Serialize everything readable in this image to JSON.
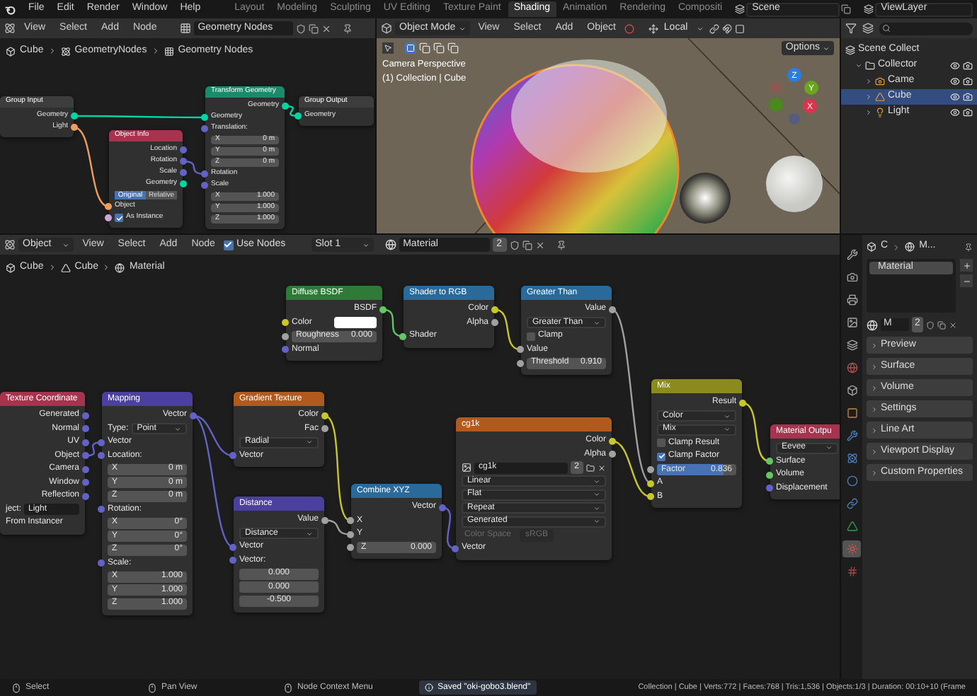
{
  "menu": [
    "File",
    "Edit",
    "Render",
    "Window",
    "Help"
  ],
  "workspaces": [
    {
      "label": "Layout",
      "selected": false
    },
    {
      "label": "Modeling",
      "selected": false
    },
    {
      "label": "Sculpting",
      "selected": false
    },
    {
      "label": "UV Editing",
      "selected": false
    },
    {
      "label": "Texture Paint",
      "selected": false
    },
    {
      "label": "Shading",
      "selected": true
    },
    {
      "label": "Animation",
      "selected": false
    },
    {
      "label": "Rendering",
      "selected": false
    },
    {
      "label": "Compositi",
      "selected": false
    }
  ],
  "scene": "Scene",
  "view_layer": "ViewLayer",
  "geometry_editor": {
    "menu": [
      "View",
      "Select",
      "Add",
      "Node"
    ],
    "node_group": "Geometry Nodes",
    "breadcrumb": [
      "Cube",
      "GeometryNodes",
      "Geometry Nodes"
    ],
    "nodes": [
      {
        "title": "Group Input",
        "color": "#3d3d3d",
        "rows": [
          {
            "kind": "output",
            "label": "Geometry",
            "color": "#00d6a3"
          },
          {
            "kind": "output",
            "label": "Light",
            "color": "#ed9e5c"
          }
        ]
      },
      {
        "title": "Transform Geometry",
        "color": "#1b8a6b",
        "rows": [
          {
            "kind": "output",
            "label": "Geometry",
            "color": "#00d6a3"
          },
          {
            "kind": "input",
            "label": "Geometry",
            "color": "#00d6a3"
          },
          {
            "kind": "input",
            "label": "Translation:",
            "color": "#6363c7"
          },
          {
            "kind": "field",
            "label": "X",
            "value": "0 m"
          },
          {
            "kind": "field",
            "label": "Y",
            "value": "0 m"
          },
          {
            "kind": "field",
            "label": "Z",
            "value": "0 m"
          },
          {
            "kind": "input",
            "label": "Rotation",
            "color": "#6363c7"
          },
          {
            "kind": "input",
            "label": "Scale",
            "color": "#6363c7"
          },
          {
            "kind": "field",
            "label": "X",
            "value": "1.000"
          },
          {
            "kind": "field",
            "label": "Y",
            "value": "1.000"
          },
          {
            "kind": "field",
            "label": "Z",
            "value": "1.000"
          }
        ]
      },
      {
        "title": "Group Output",
        "color": "#3d3d3d",
        "rows": [
          {
            "kind": "input",
            "label": "Geometry",
            "color": "#00d6a3"
          }
        ]
      },
      {
        "title": "Object Info",
        "color": "#a8334f",
        "rows": [
          {
            "kind": "output",
            "label": "Location",
            "color": "#6363c7"
          },
          {
            "kind": "output",
            "label": "Rotation",
            "color": "#6363c7"
          },
          {
            "kind": "output",
            "label": "Scale",
            "color": "#6363c7"
          },
          {
            "kind": "output",
            "label": "Geometry",
            "color": "#00d6a3"
          },
          {
            "kind": "toggle",
            "options": [
              {
                "label": "Original",
                "selected": true
              },
              {
                "label": "Relative",
                "selected": false
              }
            ]
          },
          {
            "kind": "input",
            "label": "Object",
            "color": "#ed9e5c"
          },
          {
            "kind": "checkbox",
            "label": "As Instance",
            "checked": true,
            "color": "#cca6d6"
          }
        ]
      }
    ]
  },
  "viewport": {
    "mode": "Object Mode",
    "menu": [
      "View",
      "Select",
      "Add",
      "Object"
    ],
    "orientation": "Local",
    "options": "Options",
    "overlay_lines": [
      "Camera Perspective",
      "(1) Collection | Cube"
    ],
    "gizmo_axes": [
      "Z",
      "Y",
      "X"
    ]
  },
  "outliner": {
    "items": [
      {
        "label": "Scene Collect",
        "kind": "scene",
        "selected": false,
        "children": [
          {
            "label": "Collector",
            "kind": "collection",
            "selected": false,
            "children": [
              {
                "label": "Came",
                "kind": "camera",
                "selected": false
              },
              {
                "label": "Cube",
                "kind": "mesh",
                "selected": true
              },
              {
                "label": "Light",
                "kind": "light",
                "selected": false
              }
            ]
          }
        ]
      }
    ]
  },
  "shader_editor": {
    "object_mode": "Object",
    "menu": [
      "View",
      "Select",
      "Add",
      "Node"
    ],
    "use_nodes": {
      "label": "Use Nodes",
      "checked": true
    },
    "slot": "Slot 1",
    "material": "Material",
    "users": "2",
    "breadcrumb": [
      "Cube",
      "Cube",
      "Material"
    ],
    "nodes": [
      {
        "title": "Diffuse BSDF",
        "color": "#2e7a36",
        "rows": [
          {
            "kind": "output",
            "label": "BSDF",
            "color": "#63c763"
          },
          {
            "kind": "swatch",
            "label": "Color",
            "color": "#c7c729"
          },
          {
            "kind": "field",
            "label": "Roughness",
            "value": "0.000",
            "color": "#a1a1a1"
          },
          {
            "kind": "input",
            "label": "Normal",
            "color": "#6363c7"
          }
        ]
      },
      {
        "title": "Shader to RGB",
        "color": "#2a6a9a",
        "rows": [
          {
            "kind": "output",
            "label": "Color",
            "color": "#c7c729"
          },
          {
            "kind": "output",
            "label": "Alpha",
            "color": "#a1a1a1"
          },
          {
            "kind": "input",
            "label": "Shader",
            "color": "#63c763"
          }
        ]
      },
      {
        "title": "Greater Than",
        "color": "#2a6a9a",
        "rows": [
          {
            "kind": "output",
            "label": "Value",
            "color": "#a1a1a1"
          },
          {
            "kind": "dropdown",
            "value": "Greater Than"
          },
          {
            "kind": "checkbox",
            "label": "Clamp",
            "checked": false
          },
          {
            "kind": "input",
            "label": "Value",
            "color": "#a1a1a1"
          },
          {
            "kind": "field",
            "label": "Threshold",
            "value": "0.910",
            "color": "#a1a1a1"
          }
        ]
      },
      {
        "title": "Texture Coordinate",
        "color": "#a8334f",
        "rows": [
          {
            "kind": "output",
            "label": "Generated",
            "color": "#6363c7"
          },
          {
            "kind": "output",
            "label": "Normal",
            "color": "#6363c7"
          },
          {
            "kind": "output",
            "label": "UV",
            "color": "#6363c7"
          },
          {
            "kind": "output",
            "label": "Object",
            "color": "#6363c7"
          },
          {
            "kind": "output",
            "label": "Camera",
            "color": "#6363c7"
          },
          {
            "kind": "output",
            "label": "Window",
            "color": "#6363c7"
          },
          {
            "kind": "output",
            "label": "Reflection",
            "color": "#6363c7"
          },
          {
            "kind": "object",
            "label": "ject:",
            "value": "Light"
          },
          {
            "kind": "text",
            "label": "From Instancer"
          }
        ]
      },
      {
        "title": "Mapping",
        "color": "#4b3fa0",
        "rows": [
          {
            "kind": "output",
            "label": "Vector",
            "color": "#6363c7"
          },
          {
            "kind": "dropdown",
            "label": "Type:",
            "value": "Point"
          },
          {
            "kind": "input",
            "label": "Vector",
            "color": "#6363c7"
          },
          {
            "kind": "input",
            "label": "Location:",
            "color": "#6363c7"
          },
          {
            "kind": "field",
            "label": "X",
            "value": "0 m"
          },
          {
            "kind": "field",
            "label": "Y",
            "value": "0 m"
          },
          {
            "kind": "field",
            "label": "Z",
            "value": "0 m"
          },
          {
            "kind": "input",
            "label": "Rotation:",
            "color": "#6363c7"
          },
          {
            "kind": "field",
            "label": "X",
            "value": "0°"
          },
          {
            "kind": "field",
            "label": "Y",
            "value": "0°"
          },
          {
            "kind": "field",
            "label": "Z",
            "value": "0°"
          },
          {
            "kind": "input",
            "label": "Scale:",
            "color": "#6363c7"
          },
          {
            "kind": "field",
            "label": "X",
            "value": "1.000"
          },
          {
            "kind": "field",
            "label": "Y",
            "value": "1.000"
          },
          {
            "kind": "field",
            "label": "Z",
            "value": "1.000"
          }
        ]
      },
      {
        "title": "Gradient Texture",
        "color": "#b05a1e",
        "rows": [
          {
            "kind": "output",
            "label": "Color",
            "color": "#c7c729"
          },
          {
            "kind": "output",
            "label": "Fac",
            "color": "#a1a1a1"
          },
          {
            "kind": "dropdown",
            "value": "Radial"
          },
          {
            "kind": "input",
            "label": "Vector",
            "color": "#6363c7"
          }
        ]
      },
      {
        "title": "Distance",
        "color": "#4b3fa0",
        "rows": [
          {
            "kind": "output",
            "label": "Value",
            "color": "#a1a1a1"
          },
          {
            "kind": "dropdown",
            "value": "Distance"
          },
          {
            "kind": "input",
            "label": "Vector",
            "color": "#6363c7"
          },
          {
            "kind": "input",
            "label": "Vector:",
            "color": "#6363c7"
          },
          {
            "kind": "field",
            "value": "0.000"
          },
          {
            "kind": "field",
            "value": "0.000"
          },
          {
            "kind": "field",
            "value": "-0.500"
          }
        ]
      },
      {
        "title": "Combine XYZ",
        "color": "#2a6a9a",
        "rows": [
          {
            "kind": "output",
            "label": "Vector",
            "color": "#6363c7"
          },
          {
            "kind": "input",
            "label": "X",
            "color": "#a1a1a1"
          },
          {
            "kind": "input",
            "label": "Y",
            "color": "#a1a1a1"
          },
          {
            "kind": "field",
            "label": "Z",
            "value": "0.000",
            "color": "#a1a1a1"
          }
        ]
      },
      {
        "title": "cg1k",
        "color": "#b05a1e",
        "rows": [
          {
            "kind": "output",
            "label": "Color",
            "color": "#c7c729"
          },
          {
            "kind": "output",
            "label": "Alpha",
            "color": "#a1a1a1"
          },
          {
            "kind": "image",
            "value": "cg1k",
            "users": "2"
          },
          {
            "kind": "dropdown",
            "value": "Linear"
          },
          {
            "kind": "dropdown",
            "value": "Flat"
          },
          {
            "kind": "dropdown",
            "value": "Repeat"
          },
          {
            "kind": "dropdown",
            "value": "Generated"
          },
          {
            "kind": "disabled-field",
            "label": "Color Space",
            "value": "sRGB"
          },
          {
            "kind": "input",
            "label": "Vector",
            "color": "#6363c7"
          }
        ]
      },
      {
        "title": "Mix",
        "color": "#8a8a1e",
        "rows": [
          {
            "kind": "output",
            "label": "Result",
            "color": "#c7c729"
          },
          {
            "kind": "dropdown",
            "value": "Color"
          },
          {
            "kind": "dropdown",
            "value": "Mix"
          },
          {
            "kind": "checkbox",
            "label": "Clamp Result",
            "checked": false
          },
          {
            "kind": "checkbox",
            "label": "Clamp Factor",
            "checked": true
          },
          {
            "kind": "slider",
            "label": "Factor",
            "value": "0.836",
            "level": 0.836,
            "color": "#a1a1a1"
          },
          {
            "kind": "input",
            "label": "A",
            "color": "#c7c729"
          },
          {
            "kind": "input",
            "label": "B",
            "color": "#c7c729"
          }
        ]
      },
      {
        "title": "Material Outpu",
        "color": "#a8334f",
        "rows": [
          {
            "kind": "dropdown",
            "value": "Eevee"
          },
          {
            "kind": "input",
            "label": "Surface",
            "color": "#63c763"
          },
          {
            "kind": "input",
            "label": "Volume",
            "color": "#63c763"
          },
          {
            "kind": "input",
            "label": "Displacement",
            "color": "#6363c7"
          }
        ]
      }
    ]
  },
  "property_tabs": [
    {
      "selected": false
    },
    {
      "selected": false
    },
    {
      "selected": false
    },
    {
      "selected": false
    },
    {
      "selected": false
    },
    {
      "selected": false
    },
    {
      "selected": false
    },
    {
      "selected": false
    },
    {
      "selected": false
    },
    {
      "selected": false
    },
    {
      "selected": false
    },
    {
      "selected": false
    },
    {
      "selected": false
    },
    {
      "selected": true
    },
    {
      "selected": false
    }
  ],
  "properties": {
    "breadcrumb": [
      "C",
      "M..."
    ],
    "slots": [
      {
        "label": "Material",
        "selected": true
      }
    ],
    "material_field": "M",
    "users": "2",
    "panels": [
      "Preview",
      "Surface",
      "Volume",
      "Settings",
      "Line Art",
      "Viewport Display",
      "Custom Properties"
    ]
  },
  "status_bar": {
    "hints": [
      "Select",
      "Pan View",
      "Node Context Menu"
    ],
    "message": "Saved \"oki-gobo3.blend\"",
    "stats": "Collection | Cube | Verts:772 | Faces:768 | Tris:1,536 | Objects:1/3 | Duration: 00:10+10 (Frame"
  }
}
